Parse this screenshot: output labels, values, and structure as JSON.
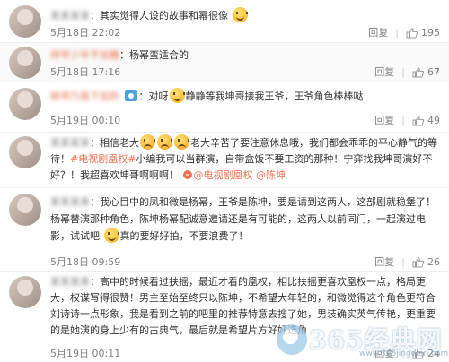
{
  "common": {
    "reply": "回复"
  },
  "comments": [
    {
      "user": "某某某某",
      "text": "其实觉得人设的故事和幂很像",
      "time": "5月18日 22:02",
      "likes": "195"
    },
    {
      "user": "帅爷少年不加糖",
      "text": "杨幂蛮适合的",
      "time": "5月18日 17:16",
      "likes": "67"
    },
    {
      "user": "她爷乃我下加的",
      "text_a": "对呀",
      "text_b": "静静等我坤哥接我王爷，王爷角色棒棒哒",
      "time": "5月19日 00:10",
      "likes": "49"
    },
    {
      "user": "某某某某",
      "text_a": "相信老大",
      "text_b": "老大辛苦了要注意休息哦，我们都会乖乖的平心静气的等待！",
      "tag": "#电视剧凰权#",
      "text_c": "小编我可以当群演，自带盒饭不要工资的那种！宁弈找我坤哥演好不好？！我超喜欢坤哥啊啊啊！",
      "mention_a": "@电视剧凰权",
      "mention_b": "@陈坤",
      "time": "5月18日 22:17",
      "likes": "35"
    },
    {
      "user": "某某某某",
      "text_a": "我心目中的凤和微是杨幂，王爷是陈坤，要是请到这两人，这部剧就稳堡了！杨幂替演那种角色，陈坤杨幂配诚意邀请还是有可能的，这两人以前同门，一起演过电影，试试吧",
      "text_b": "真的要好好拍，不要浪费了！",
      "time": "5月18日 09:59",
      "likes": "26"
    },
    {
      "user": "某某某某",
      "text": "高中的时候看过扶摇，最近才看的凰权，相比扶摇更喜欢凰权一点，格局更大，权谋写得很赞！男主至始至终只以陈坤，不希望大年轻的，和微觉得这个角色更符合刘诗诗一点形象，我是看到之前的吧里的推荐特意去搜了她，男装确实英气传艳，更重要的是她演的身上少有的古典气，最后就是希望片方好好选角",
      "time": "5月19日 00:11",
      "likes": "24"
    }
  ],
  "watermark": {
    "text": "365经典网",
    "url": "www.365jingdian.com"
  },
  "colors": {
    "accent": "#eb7350",
    "meta": "#808080",
    "divider": "#eeeeee"
  }
}
